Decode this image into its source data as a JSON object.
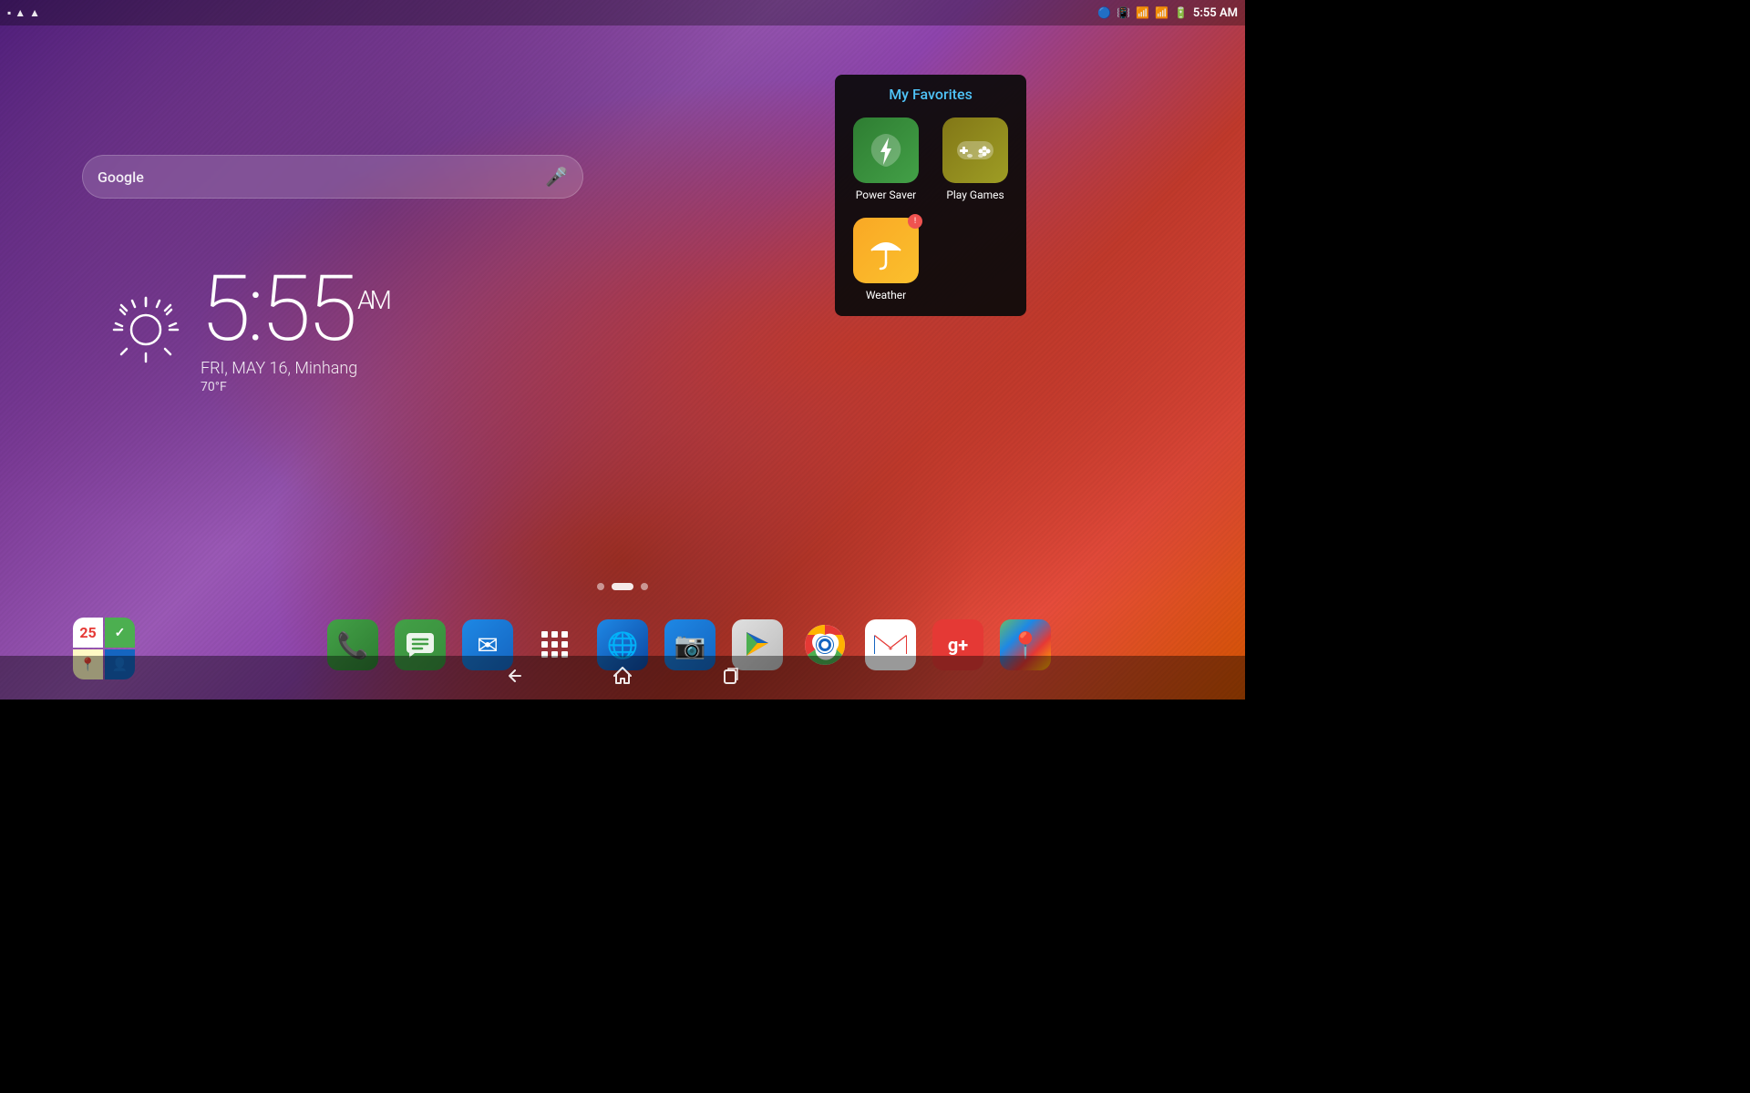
{
  "statusBar": {
    "time": "5:55 AM",
    "icons": {
      "bluetooth": "🔵",
      "notification1": "▲",
      "notification2": "▲",
      "wifi": "WiFi",
      "signal": "Signal",
      "battery": "Battery"
    },
    "leftIcons": [
      "▪",
      "▲",
      "▲"
    ]
  },
  "searchBar": {
    "label": "Google",
    "placeholder": "Google"
  },
  "clock": {
    "time": "5:55",
    "ampm": "AM",
    "date": "FRI, MAY 16, Minhang",
    "temp": "70°F"
  },
  "pageIndicator": {
    "dots": [
      "left",
      "active",
      "right"
    ]
  },
  "favorites": {
    "title": "My Favorites",
    "apps": [
      {
        "name": "Power Saver",
        "icon": "leaf",
        "type": "power-saver",
        "badge": null
      },
      {
        "name": "Play Games",
        "icon": "gamepad",
        "type": "play-games",
        "badge": null
      },
      {
        "name": "Weather",
        "icon": "umbrella",
        "type": "weather",
        "badge": "!"
      }
    ]
  },
  "dockApps": {
    "left": [
      {
        "name": "Calendar & Apps",
        "type": "multi"
      }
    ],
    "center": [
      {
        "name": "Phone",
        "icon": "📞",
        "bg": "phone"
      },
      {
        "name": "Messages",
        "icon": "💬",
        "bg": "sms"
      },
      {
        "name": "Email",
        "icon": "✉",
        "bg": "mail"
      },
      {
        "name": "All Apps",
        "icon": "grid",
        "bg": "allapps"
      },
      {
        "name": "Browser",
        "icon": "🌐",
        "bg": "browser"
      },
      {
        "name": "Camera",
        "icon": "📷",
        "bg": "camera"
      },
      {
        "name": "Play Store",
        "icon": "▶",
        "bg": "play"
      }
    ],
    "right": [
      {
        "name": "Chrome",
        "icon": "C"
      },
      {
        "name": "Gmail",
        "icon": "M"
      },
      {
        "name": "Google+",
        "icon": "g+"
      },
      {
        "name": "Maps",
        "icon": "📍"
      }
    ]
  },
  "navBar": {
    "back": "◀",
    "home": "⌂",
    "recents": "▣"
  }
}
